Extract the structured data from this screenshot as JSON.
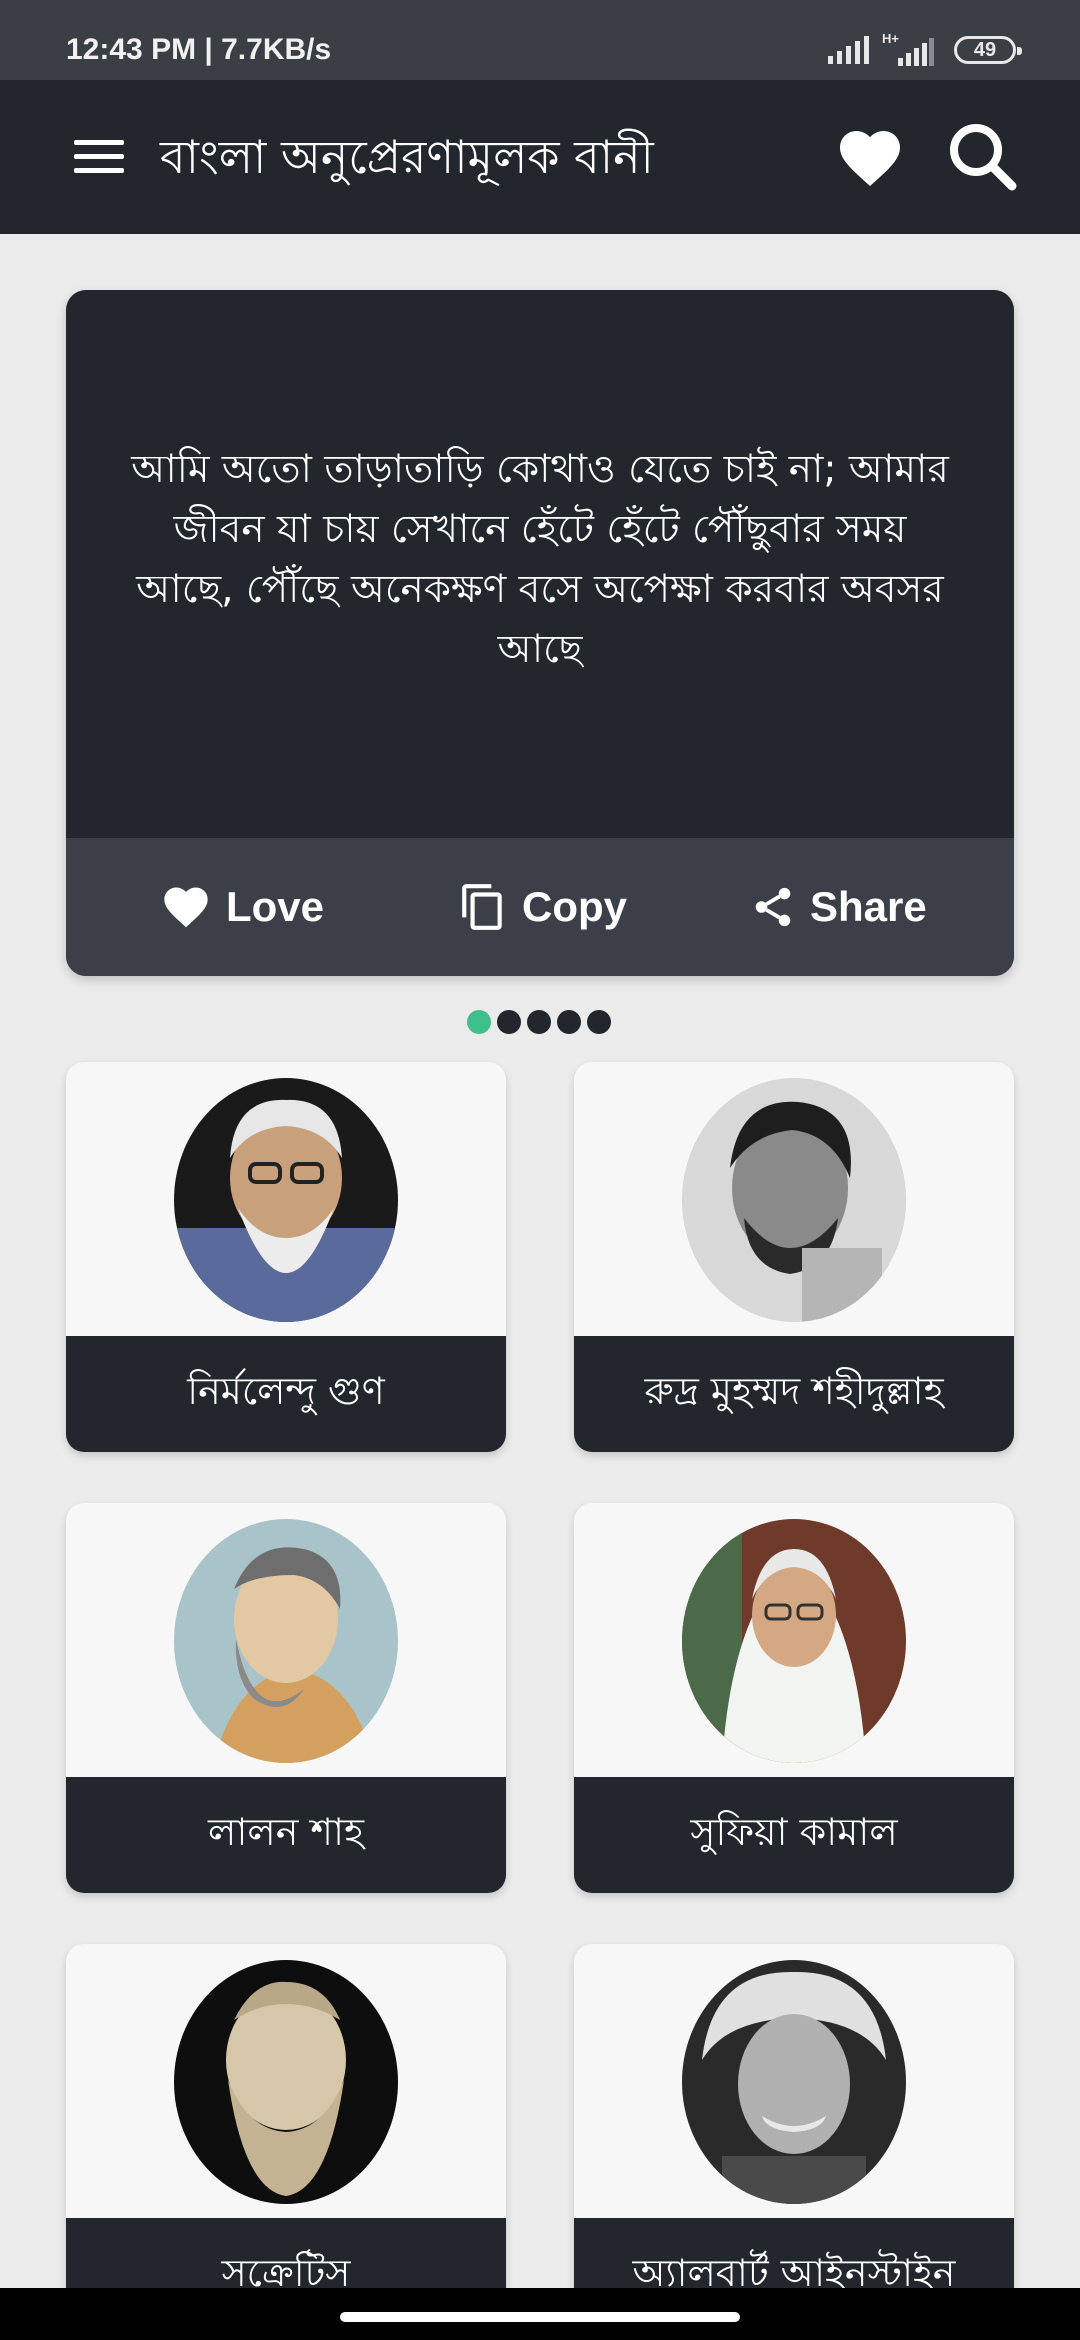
{
  "status_bar": {
    "time": "12:43 PM | 7.7KB/s",
    "battery": "49",
    "network_label": "H+"
  },
  "app_bar": {
    "title": "বাংলা অনুপ্রেরণামূলক বানী",
    "icons": [
      "menu-icon",
      "heart-icon",
      "search-icon"
    ]
  },
  "quote": {
    "text": "আমি অতো তাড়াতাড়ি কোথাও যেতে চাই না; আমার জীবন যা চায় সেখানে হেঁটে হেঁটে পৌঁছুবার সময় আছে, পৌঁছে অনেকক্ষণ বসে অপেক্ষা করবার অবসর আছে",
    "actions": {
      "love": "Love",
      "copy": "Copy",
      "share": "Share"
    }
  },
  "pager": {
    "count": 5,
    "active_index": 0
  },
  "authors": [
    {
      "name": "নির্মলেন্দু গুণ"
    },
    {
      "name": "রুদ্র মুহম্মদ শহীদুল্লাহ"
    },
    {
      "name": "লালন শাহ"
    },
    {
      "name": "সুফিয়া কামাল"
    },
    {
      "name": "সক্রেটিস"
    },
    {
      "name": "অ্যালবার্ট আইনস্টাইন"
    }
  ],
  "colors": {
    "app_bar": "#22262d",
    "accent": "#3fbf8c",
    "background": "#ebebeb",
    "action_bar": "#3b3f47"
  }
}
